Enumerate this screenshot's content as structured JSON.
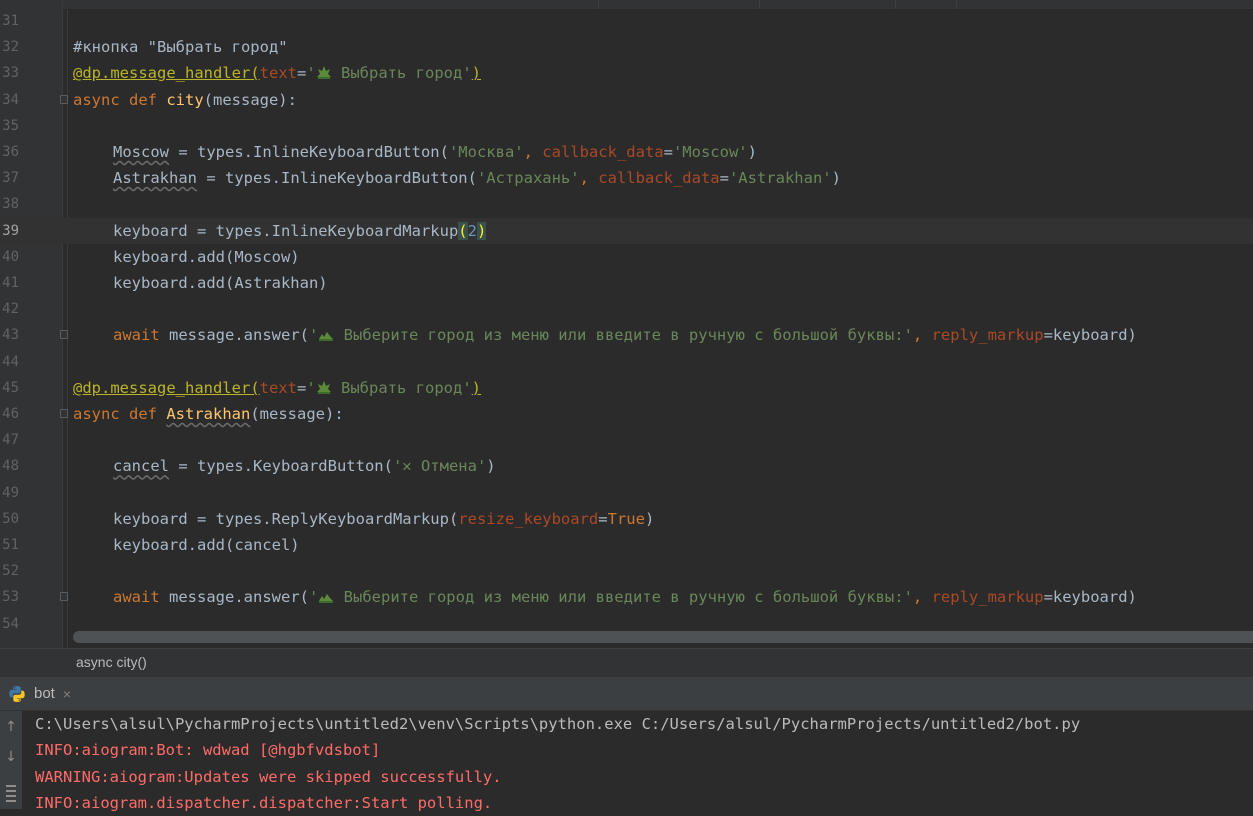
{
  "editor": {
    "lines": [
      {
        "n": "31",
        "indent": 0,
        "tokens": []
      },
      {
        "n": "32",
        "indent": 0,
        "tokens": [
          {
            "t": "#кнопка \"Выбрать город\"",
            "c": "cmt"
          }
        ]
      },
      {
        "n": "33",
        "indent": 0,
        "tokens": [
          {
            "t": "@dp.message_handler",
            "c": "dec"
          },
          {
            "t": "(",
            "c": "dec"
          },
          {
            "t": "text",
            "c": "par"
          },
          {
            "t": "=",
            "c": ""
          },
          {
            "t": "'",
            "c": "str"
          },
          {
            "plant": true
          },
          {
            "t": " Выбрать город",
            "c": "str"
          },
          {
            "t": "'",
            "c": "str"
          },
          {
            "t": ")",
            "c": "dec"
          }
        ]
      },
      {
        "n": "34",
        "indent": 0,
        "fold": true,
        "tokens": [
          {
            "t": "async def ",
            "c": "kw"
          },
          {
            "t": "city",
            "c": "fn"
          },
          {
            "t": "(message):",
            "c": ""
          }
        ]
      },
      {
        "n": "35",
        "indent": 0,
        "tokens": []
      },
      {
        "n": "36",
        "indent": 1,
        "tokens": [
          {
            "t": "Moscow",
            "c": "und"
          },
          {
            "t": " = types.InlineKeyboardButton(",
            "c": ""
          },
          {
            "t": "'Москва'",
            "c": "str"
          },
          {
            "t": ", ",
            "c": "kw"
          },
          {
            "t": "callback_data",
            "c": "par"
          },
          {
            "t": "=",
            "c": ""
          },
          {
            "t": "'Moscow'",
            "c": "str"
          },
          {
            "t": ")",
            "c": ""
          }
        ]
      },
      {
        "n": "37",
        "indent": 1,
        "tokens": [
          {
            "t": "Astrakhan",
            "c": "und"
          },
          {
            "t": " = types.InlineKeyboardButton(",
            "c": ""
          },
          {
            "t": "'Астрахань'",
            "c": "str"
          },
          {
            "t": ", ",
            "c": "kw"
          },
          {
            "t": "callback_data",
            "c": "par"
          },
          {
            "t": "=",
            "c": ""
          },
          {
            "t": "'Astrakhan'",
            "c": "str"
          },
          {
            "t": ")",
            "c": ""
          }
        ]
      },
      {
        "n": "38",
        "indent": 0,
        "tokens": []
      },
      {
        "n": "39",
        "indent": 1,
        "current": true,
        "tokens": [
          {
            "t": "keyboard = types.InlineKeyboardMarkup",
            "c": ""
          },
          {
            "t": "(",
            "c": "brk"
          },
          {
            "t": "2",
            "c": "num"
          },
          {
            "t": ")",
            "c": "brk"
          }
        ]
      },
      {
        "n": "40",
        "indent": 1,
        "tokens": [
          {
            "t": "keyboard.add(Moscow)",
            "c": ""
          }
        ]
      },
      {
        "n": "41",
        "indent": 1,
        "tokens": [
          {
            "t": "keyboard.add(Astrakhan)",
            "c": ""
          }
        ]
      },
      {
        "n": "42",
        "indent": 0,
        "tokens": []
      },
      {
        "n": "43",
        "indent": 1,
        "fold": true,
        "tokens": [
          {
            "t": "await ",
            "c": "kw"
          },
          {
            "t": "message.answer(",
            "c": ""
          },
          {
            "t": "'",
            "c": "str"
          },
          {
            "plant": true,
            "small": true
          },
          {
            "t": " Выберите город из меню или введите в ручную с большой буквы:'",
            "c": "str"
          },
          {
            "t": ", ",
            "c": "kw"
          },
          {
            "t": "reply_markup",
            "c": "par"
          },
          {
            "t": "=keyboard)",
            "c": ""
          }
        ]
      },
      {
        "n": "44",
        "indent": 0,
        "tokens": []
      },
      {
        "n": "45",
        "indent": 0,
        "tokens": [
          {
            "t": "@dp.message_handler",
            "c": "dec"
          },
          {
            "t": "(",
            "c": "dec"
          },
          {
            "t": "text",
            "c": "par"
          },
          {
            "t": "=",
            "c": ""
          },
          {
            "t": "'",
            "c": "str"
          },
          {
            "plant": true
          },
          {
            "t": " Выбрать город",
            "c": "str"
          },
          {
            "t": "'",
            "c": "str"
          },
          {
            "t": ")",
            "c": "dec"
          }
        ]
      },
      {
        "n": "46",
        "indent": 0,
        "fold": true,
        "tokens": [
          {
            "t": "async def ",
            "c": "kw"
          },
          {
            "t": "Astrakhan",
            "c": "fn und"
          },
          {
            "t": "(message):",
            "c": ""
          }
        ]
      },
      {
        "n": "47",
        "indent": 0,
        "tokens": []
      },
      {
        "n": "48",
        "indent": 1,
        "tokens": [
          {
            "t": "cancel",
            "c": "und"
          },
          {
            "t": " = types.KeyboardButton(",
            "c": ""
          },
          {
            "t": "'✕ Отмена'",
            "c": "str"
          },
          {
            "t": ")",
            "c": ""
          }
        ]
      },
      {
        "n": "49",
        "indent": 0,
        "tokens": []
      },
      {
        "n": "50",
        "indent": 1,
        "tokens": [
          {
            "t": "keyboard = types.ReplyKeyboardMarkup(",
            "c": ""
          },
          {
            "t": "resize_keyboard",
            "c": "par"
          },
          {
            "t": "=",
            "c": ""
          },
          {
            "t": "True",
            "c": "kw"
          },
          {
            "t": ")",
            "c": ""
          }
        ]
      },
      {
        "n": "51",
        "indent": 1,
        "tokens": [
          {
            "t": "keyboard.add(cancel)",
            "c": ""
          }
        ]
      },
      {
        "n": "52",
        "indent": 0,
        "tokens": []
      },
      {
        "n": "53",
        "indent": 1,
        "fold": true,
        "tokens": [
          {
            "t": "await ",
            "c": "kw"
          },
          {
            "t": "message.answer(",
            "c": ""
          },
          {
            "t": "'",
            "c": "str"
          },
          {
            "plant": true,
            "small": true
          },
          {
            "t": " Выберите город из меню или введите в ручную с большой буквы:'",
            "c": "str"
          },
          {
            "t": ", ",
            "c": "kw"
          },
          {
            "t": "reply_markup",
            "c": "par"
          },
          {
            "t": "=keyboard)",
            "c": ""
          }
        ]
      },
      {
        "n": "54",
        "indent": 0,
        "tokens": []
      }
    ]
  },
  "breadcrumb": "async city()",
  "run": {
    "tab_label": "bot",
    "tab_close": "×",
    "up_arrow": "↑",
    "down_arrow": "↓",
    "console": [
      {
        "text": "C:\\Users\\alsul\\PycharmProjects\\untitled2\\venv\\Scripts\\python.exe C:/Users/alsul/PycharmProjects/untitled2/bot.py",
        "type": "plain"
      },
      {
        "text": "INFO:aiogram:Bot: wdwad [@hgbfvdsbot]",
        "type": "err"
      },
      {
        "text": "WARNING:aiogram:Updates were skipped successfully.",
        "type": "err"
      },
      {
        "text": "INFO:aiogram.dispatcher.dispatcher:Start polling.",
        "type": "err"
      }
    ]
  },
  "icons": {
    "plant": "seedling-emoji-icon",
    "python": "python-icon",
    "close": "close-icon"
  },
  "colors": {
    "background": "#2b2b2b",
    "keyword": "#cc7832",
    "string": "#6a8759",
    "decorator": "#bbb529",
    "function": "#ffc66d",
    "error_output": "#ff6b68"
  }
}
